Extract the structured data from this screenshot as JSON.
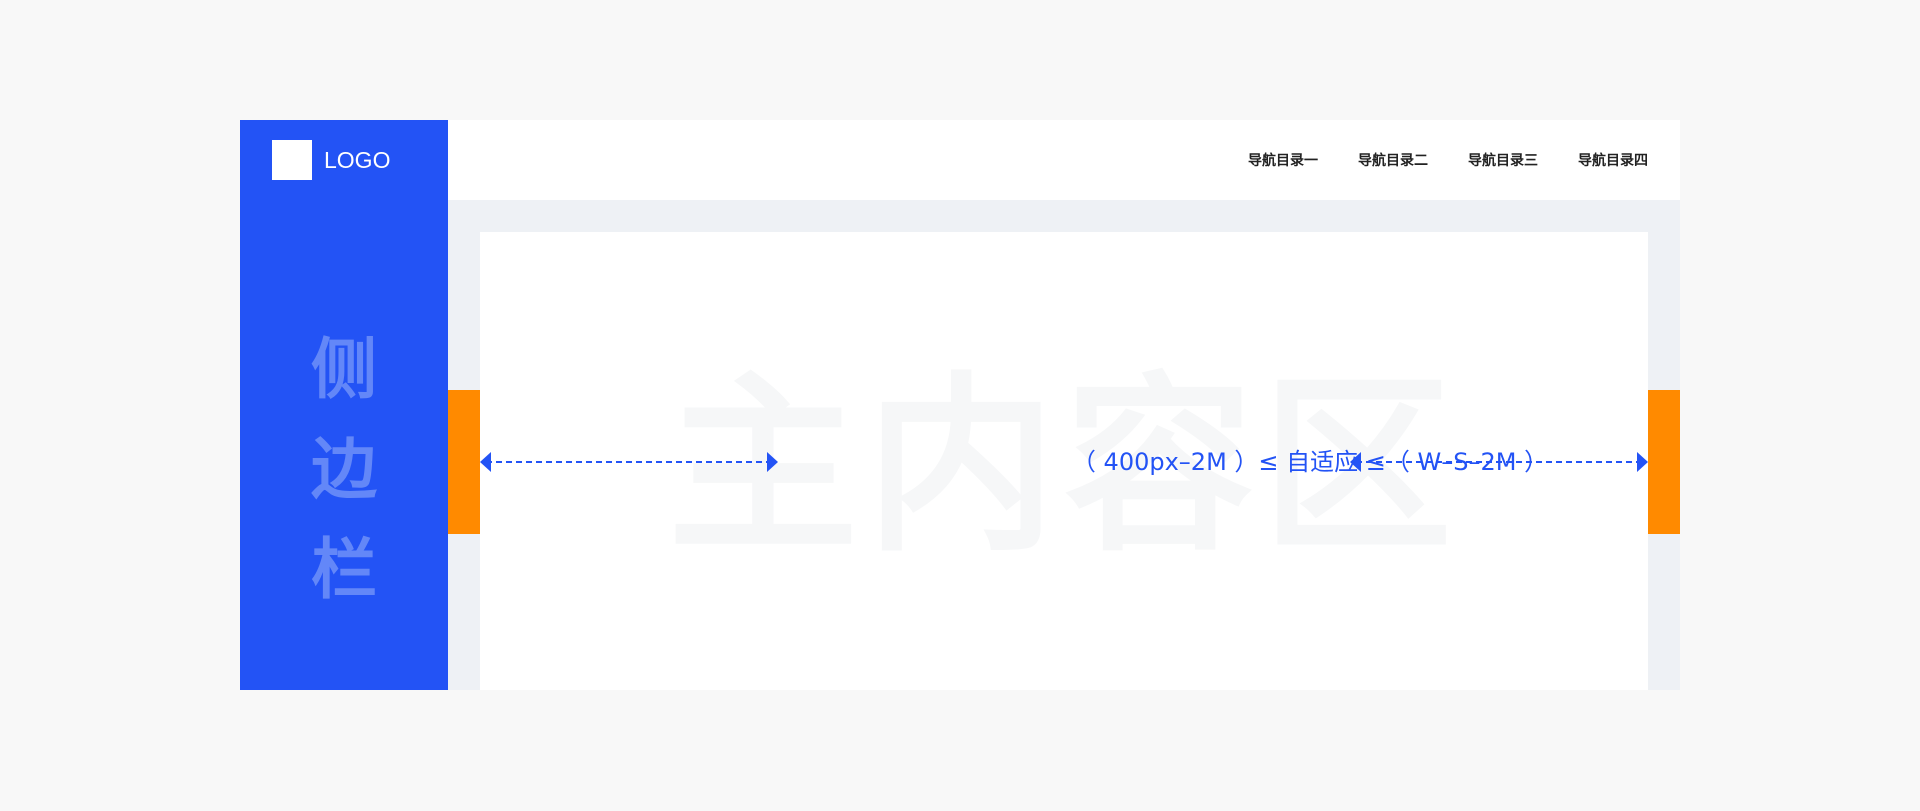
{
  "logo": {
    "text": "LOGO"
  },
  "sidebar": {
    "watermark_chars": [
      "侧",
      "边",
      "栏"
    ]
  },
  "nav": {
    "items": [
      "导航目录一",
      "导航目录二",
      "导航目录三",
      "导航目录四"
    ]
  },
  "main": {
    "watermark": "主内容区",
    "formula": "（ 400px–2M ）≤ 自适应 ≤（ W–S–2M ）"
  },
  "colors": {
    "background": "#f8f8f8",
    "frame": "#eef1f5",
    "sidebar": "#2353f5",
    "sidebar_watermark": "#6387f8",
    "margin_accent": "#ff8a00",
    "dimension_line": "#2353f5",
    "header": "#ffffff",
    "content": "#ffffff"
  }
}
